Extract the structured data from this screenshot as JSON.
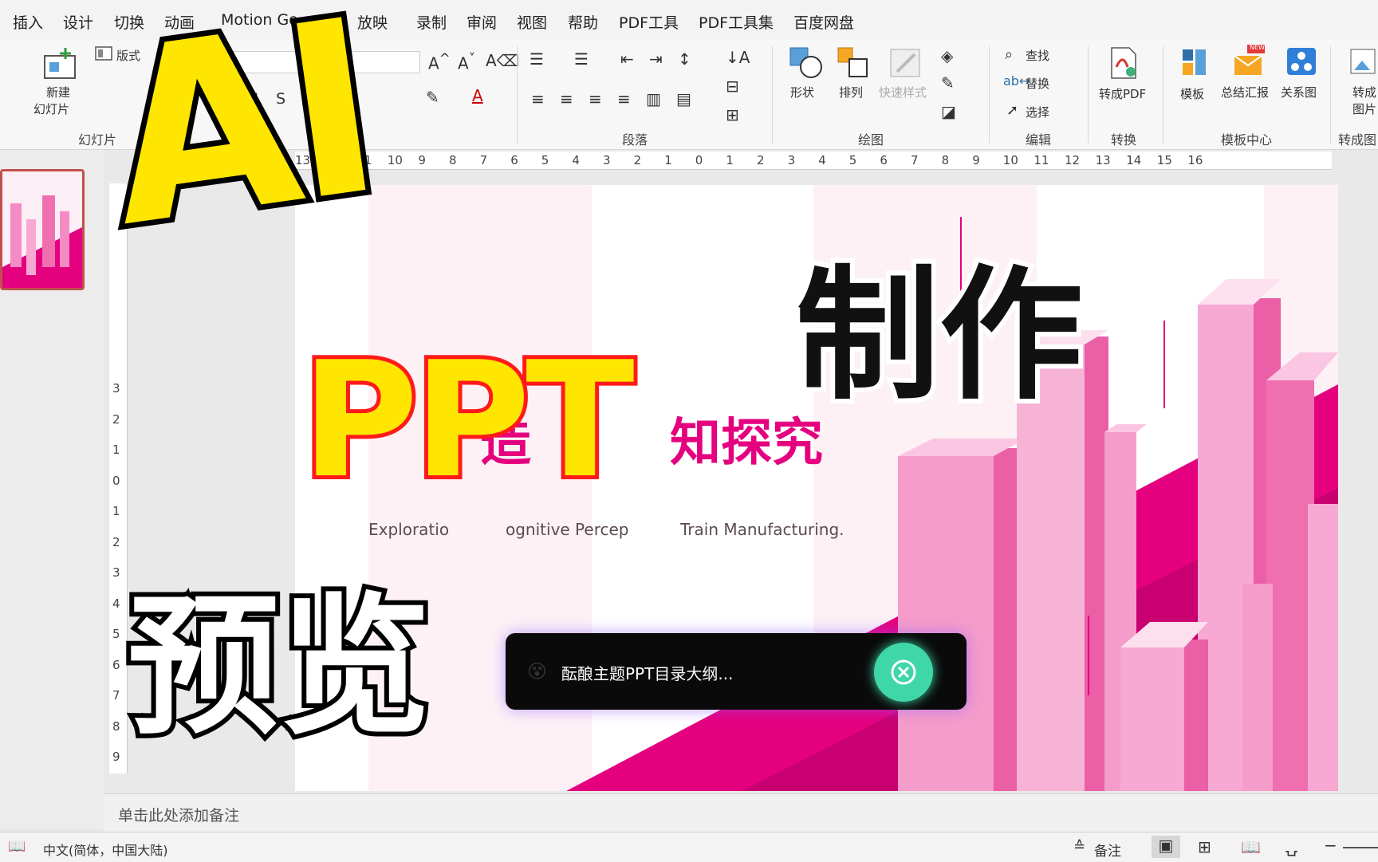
{
  "menu": [
    "插入",
    "设计",
    "切换",
    "动画",
    "Motion Go",
    "放映",
    "录制",
    "审阅",
    "视图",
    "帮助",
    "PDF工具",
    "PDF工具集",
    "百度网盘"
  ],
  "ribbon": {
    "new_slide": [
      "新建",
      "幻灯片"
    ],
    "layout": "版式",
    "slides_group": "幻灯片",
    "paragraph_group": "段落",
    "shape": "形状",
    "arrange": "排列",
    "quick_styles": "快速样式",
    "drawing_group": "绘图",
    "find": "查找",
    "replace": "替换",
    "select": "选择",
    "edit_group": "编辑",
    "to_pdf": "转成PDF",
    "convert_group": "转换",
    "template": "模板",
    "summary": "总结汇报",
    "summary_badge": "NEW",
    "relation": "关系图",
    "template_group": "模板中心",
    "to_image": [
      "转成",
      "图片"
    ],
    "convert_image_group": "转成图"
  },
  "ruler": {
    "horizontal": [
      "13",
      "12",
      "11",
      "10",
      "9",
      "8",
      "7",
      "6",
      "5",
      "4",
      "3",
      "2",
      "1",
      "0",
      "1",
      "2",
      "3",
      "4",
      "5",
      "6",
      "7",
      "8",
      "9",
      "10",
      "11",
      "12",
      "13",
      "14",
      "15",
      "16"
    ],
    "vertical": [
      "3",
      "2",
      "1",
      "0",
      "1",
      "2",
      "3",
      "4",
      "5",
      "6",
      "7",
      "8",
      "9"
    ]
  },
  "slide": {
    "title_fragment_1": "造",
    "title_fragment_2": "知探究",
    "subtitle_1": "Exploratio",
    "subtitle_2": "ognitive Percep",
    "subtitle_3": "Train Manufacturing."
  },
  "toast": {
    "text": "酝酿主题PPT目录大纲..."
  },
  "overlay": {
    "ai": "AI",
    "ppt": "PPT",
    "make": "制作",
    "preview": "预览"
  },
  "notes_placeholder": "单击此处添加备注",
  "status": {
    "language": "中文(简体，中国大陆)",
    "notes": "备注"
  },
  "colors": {
    "accent_pink": "#e4007f",
    "sticker_yellow": "#ffe600",
    "sticker_red": "#ff1a1a",
    "toast_close": "#3fd6a8"
  }
}
